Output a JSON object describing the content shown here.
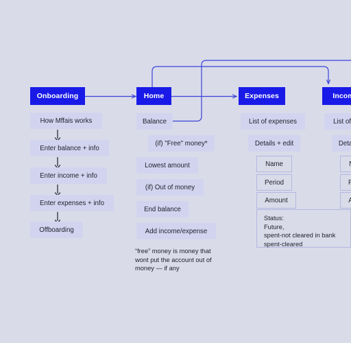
{
  "diagram": {
    "background_color": "#d9dbe9",
    "accent_color": "#1a1ae8",
    "box_color": "#d2d4ef",
    "text_color": "#20232e",
    "columns": [
      {
        "id": "onboarding",
        "header": "Onboarding",
        "items": [
          "How Mffais works",
          "Enter balance + info",
          "Enter income + info",
          "Enter expenses + info",
          "Offboarding"
        ]
      },
      {
        "id": "home",
        "header": "Home",
        "items": [
          "Balance",
          "(if) \"Free\" money*",
          "Lowest amount",
          "(if) Out of money",
          "End balance",
          "Add income/expense"
        ],
        "footnote": "“free” money is money that\nwont put the account out of\nmoney — if any"
      },
      {
        "id": "expenses",
        "header": "Expenses",
        "items": [
          "List of expenses",
          "Details + edit",
          "Name",
          "Period",
          "Amount"
        ],
        "status": "Status:\nFuture,\nspent-not cleared in bank\nspent-cleared"
      },
      {
        "id": "income",
        "header": "Income",
        "items": [
          "List of income",
          "Details + edit",
          "Name",
          "Period",
          "Amount"
        ]
      }
    ]
  }
}
